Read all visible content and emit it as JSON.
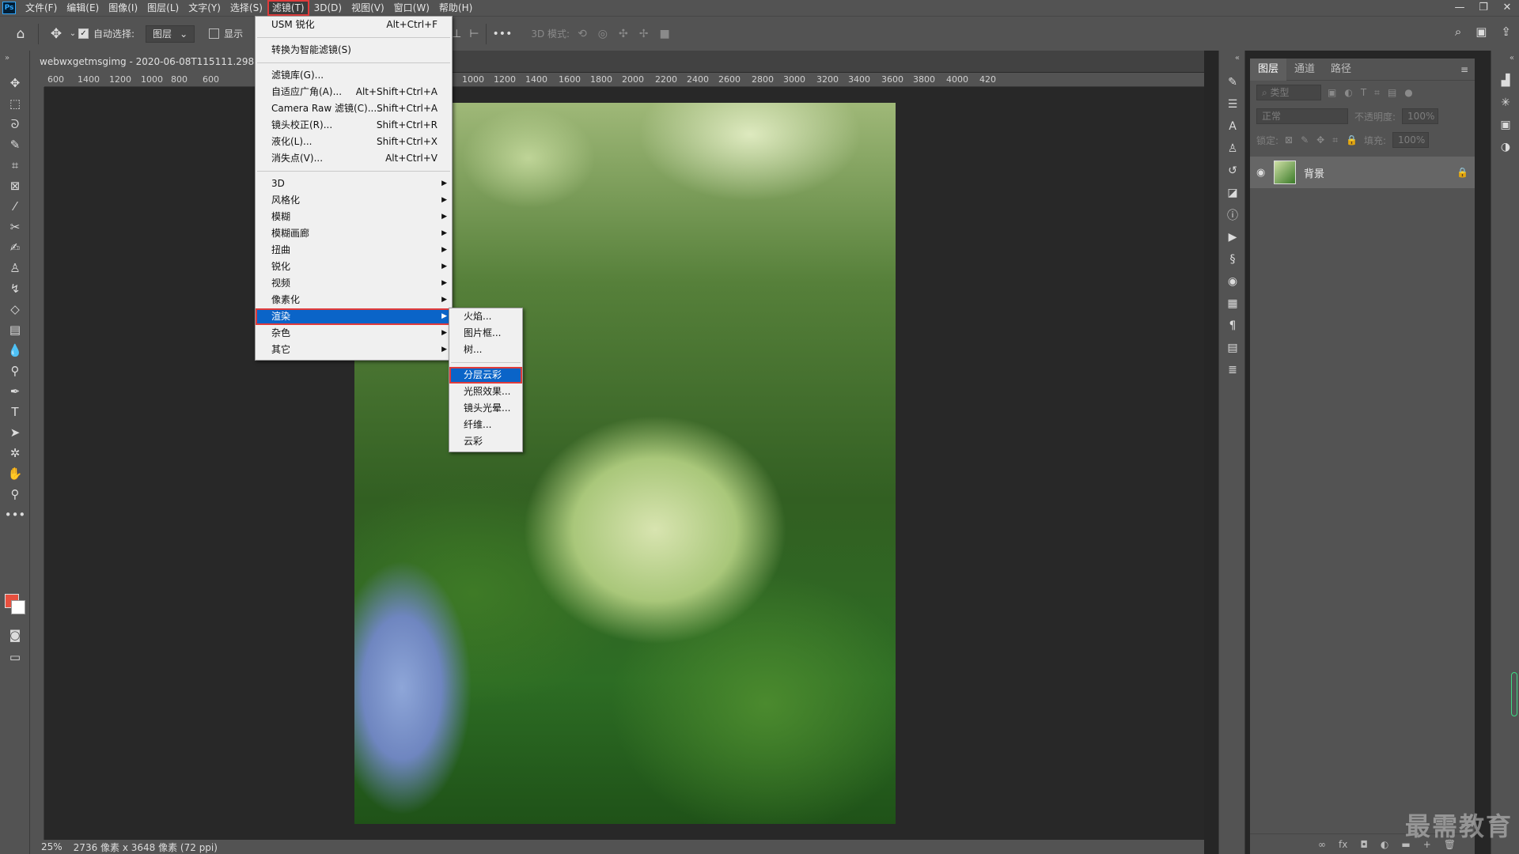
{
  "menubar": {
    "logo": "Ps",
    "items": [
      "文件(F)",
      "编辑(E)",
      "图像(I)",
      "图层(L)",
      "文字(Y)",
      "选择(S)",
      "滤镜(T)",
      "3D(D)",
      "视图(V)",
      "窗口(W)",
      "帮助(H)"
    ],
    "active_index": 6,
    "window_controls": [
      "—",
      "❐",
      "✕"
    ]
  },
  "options": {
    "auto_select_label": "自动选择:",
    "auto_select_value": "图层",
    "show_label": "显示",
    "more": "•••",
    "mode3d_label": "3D 模式:"
  },
  "document": {
    "tab_title": "webwxgetmsgimg - 2020-06-08T115111.298.jpg",
    "ruler_ticks": [
      "600",
      "1400",
      "1200",
      "1000",
      "800",
      "600",
      "600",
      "800",
      "1000",
      "1200",
      "1400",
      "1600",
      "1800",
      "2000",
      "2200",
      "2400",
      "2600",
      "2800",
      "3000",
      "3200",
      "3400",
      "3600",
      "3800",
      "4000",
      "420"
    ],
    "zoom": "25%",
    "dimensions": "2736 像素 x 3648 像素 (72 ppi)"
  },
  "filter_menu": {
    "items": [
      {
        "label": "USM 锐化",
        "shortcut": "Alt+Ctrl+F"
      },
      {
        "sep": true
      },
      {
        "label": "转换为智能滤镜(S)",
        "shortcut": ""
      },
      {
        "sep": true
      },
      {
        "label": "滤镜库(G)...",
        "shortcut": ""
      },
      {
        "label": "自适应广角(A)...",
        "shortcut": "Alt+Shift+Ctrl+A"
      },
      {
        "label": "Camera Raw 滤镜(C)...",
        "shortcut": "Shift+Ctrl+A"
      },
      {
        "label": "镜头校正(R)...",
        "shortcut": "Shift+Ctrl+R"
      },
      {
        "label": "液化(L)...",
        "shortcut": "Shift+Ctrl+X"
      },
      {
        "label": "消失点(V)...",
        "shortcut": "Alt+Ctrl+V"
      },
      {
        "sep": true
      },
      {
        "label": "3D",
        "submenu": true
      },
      {
        "label": "风格化",
        "submenu": true
      },
      {
        "label": "模糊",
        "submenu": true
      },
      {
        "label": "模糊画廊",
        "submenu": true
      },
      {
        "label": "扭曲",
        "submenu": true
      },
      {
        "label": "锐化",
        "submenu": true
      },
      {
        "label": "视频",
        "submenu": true
      },
      {
        "label": "像素化",
        "submenu": true
      },
      {
        "label": "渲染",
        "submenu": true,
        "highlighted": true
      },
      {
        "label": "杂色",
        "submenu": true
      },
      {
        "label": "其它",
        "submenu": true
      }
    ]
  },
  "render_submenu": {
    "items": [
      {
        "label": "火焰..."
      },
      {
        "label": "图片框..."
      },
      {
        "label": "树..."
      },
      {
        "sep": true
      },
      {
        "label": "分层云彩",
        "highlighted": true
      },
      {
        "label": "光照效果..."
      },
      {
        "label": "镜头光晕..."
      },
      {
        "label": "纤维..."
      },
      {
        "label": "云彩"
      }
    ]
  },
  "layers_panel": {
    "tabs": [
      "图层",
      "通道",
      "路径"
    ],
    "active_tab": 0,
    "filter_placeholder": "类型",
    "blend_mode": "正常",
    "opacity_label": "不透明度:",
    "opacity_value": "100%",
    "lock_label": "锁定:",
    "fill_label": "填充:",
    "fill_value": "100%",
    "layer_name": "背景",
    "bottom_icons": [
      "∞",
      "fx",
      "◘",
      "◐",
      "▬",
      "+",
      "🗑"
    ]
  },
  "watermark": "最需教育",
  "colors": {
    "foreground": "#e8503f",
    "background": "#ffffff",
    "highlight": "#0a64c8",
    "annotation_red": "#e03b3b"
  }
}
